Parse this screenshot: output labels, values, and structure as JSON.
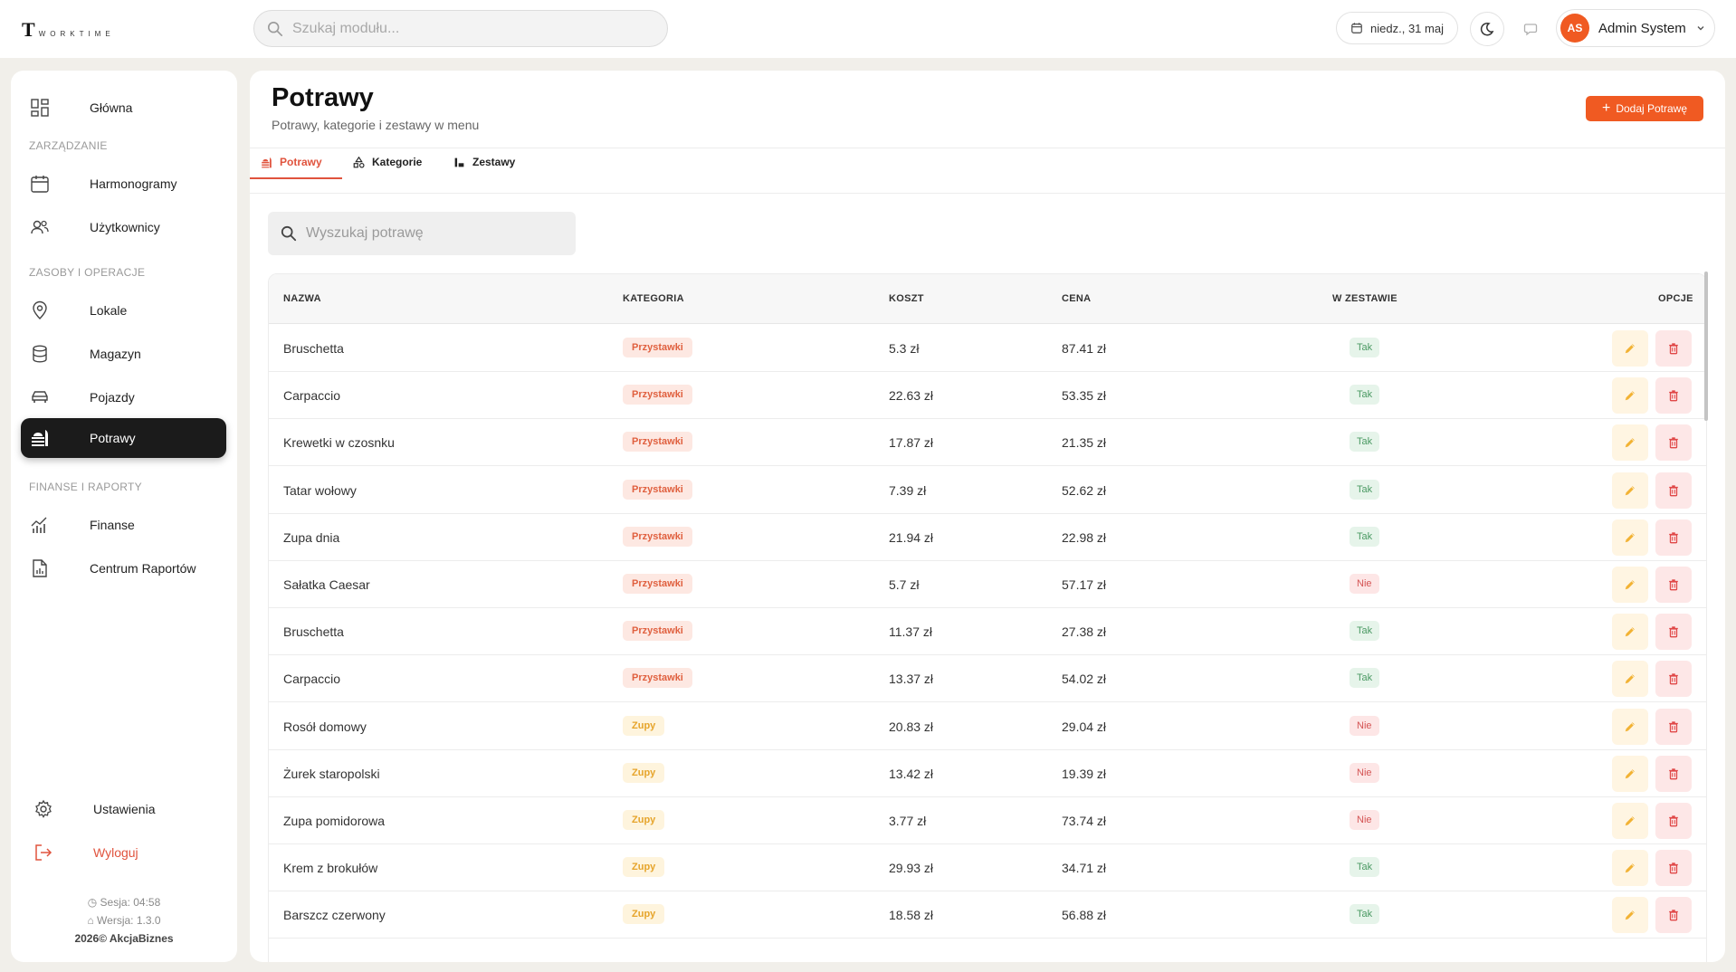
{
  "app": {
    "logo_letter": "T",
    "logo_text": "WORKTIME",
    "search_placeholder": "Szukaj modułu...",
    "date": "niedz., 31 maj",
    "user_initials": "AS",
    "user_name": "Admin System"
  },
  "sidebar": {
    "home": "Główna",
    "section_management": "ZARZĄDZANIE",
    "schedules": "Harmonogramy",
    "users": "Użytkownicy",
    "section_resources": "ZASOBY I OPERACJE",
    "locations": "Lokale",
    "warehouse": "Magazyn",
    "vehicles": "Pojazdy",
    "dishes": "Potrawy",
    "section_finance": "FINANSE I RAPORTY",
    "finance": "Finanse",
    "reports": "Centrum Raportów",
    "settings": "Ustawienia",
    "logout": "Wyloguj",
    "session": "Sesja: 04:58",
    "version": "Wersja: 1.3.0",
    "copyright": "2026© AkcjaBiznes"
  },
  "page": {
    "title": "Potrawy",
    "subtitle": "Potrawy, kategorie i zestawy w menu",
    "add_button": "Dodaj Potrawę",
    "tabs": [
      "Potrawy",
      "Kategorie",
      "Zestawy"
    ],
    "search_placeholder": "Wyszukaj potrawę"
  },
  "table": {
    "headers": [
      "NAZWA",
      "KATEGORIA",
      "KOSZT",
      "CENA",
      "W ZESTAWIE",
      "OPCJE"
    ],
    "rows": [
      {
        "name": "Bruschetta",
        "category": "Przystawki",
        "cost": "5.3 zł",
        "price": "87.41 zł",
        "in_set": "Tak"
      },
      {
        "name": "Carpaccio",
        "category": "Przystawki",
        "cost": "22.63 zł",
        "price": "53.35 zł",
        "in_set": "Tak"
      },
      {
        "name": "Krewetki w czosnku",
        "category": "Przystawki",
        "cost": "17.87 zł",
        "price": "21.35 zł",
        "in_set": "Tak"
      },
      {
        "name": "Tatar wołowy",
        "category": "Przystawki",
        "cost": "7.39 zł",
        "price": "52.62 zł",
        "in_set": "Tak"
      },
      {
        "name": "Zupa dnia",
        "category": "Przystawki",
        "cost": "21.94 zł",
        "price": "22.98 zł",
        "in_set": "Tak"
      },
      {
        "name": "Sałatka Caesar",
        "category": "Przystawki",
        "cost": "5.7 zł",
        "price": "57.17 zł",
        "in_set": "Nie"
      },
      {
        "name": "Bruschetta",
        "category": "Przystawki",
        "cost": "11.37 zł",
        "price": "27.38 zł",
        "in_set": "Tak"
      },
      {
        "name": "Carpaccio",
        "category": "Przystawki",
        "cost": "13.37 zł",
        "price": "54.02 zł",
        "in_set": "Tak"
      },
      {
        "name": "Rosół domowy",
        "category": "Zupy",
        "cost": "20.83 zł",
        "price": "29.04 zł",
        "in_set": "Nie"
      },
      {
        "name": "Żurek staropolski",
        "category": "Zupy",
        "cost": "13.42 zł",
        "price": "19.39 zł",
        "in_set": "Nie"
      },
      {
        "name": "Zupa pomidorowa",
        "category": "Zupy",
        "cost": "3.77 zł",
        "price": "73.74 zł",
        "in_set": "Nie"
      },
      {
        "name": "Krem z brokułów",
        "category": "Zupy",
        "cost": "29.93 zł",
        "price": "34.71 zł",
        "in_set": "Tak"
      },
      {
        "name": "Barszcz czerwony",
        "category": "Zupy",
        "cost": "18.58 zł",
        "price": "56.88 zł",
        "in_set": "Tak"
      }
    ]
  },
  "colors": {
    "accent": "#f05a22",
    "active_nav": "#1b1b1b"
  }
}
